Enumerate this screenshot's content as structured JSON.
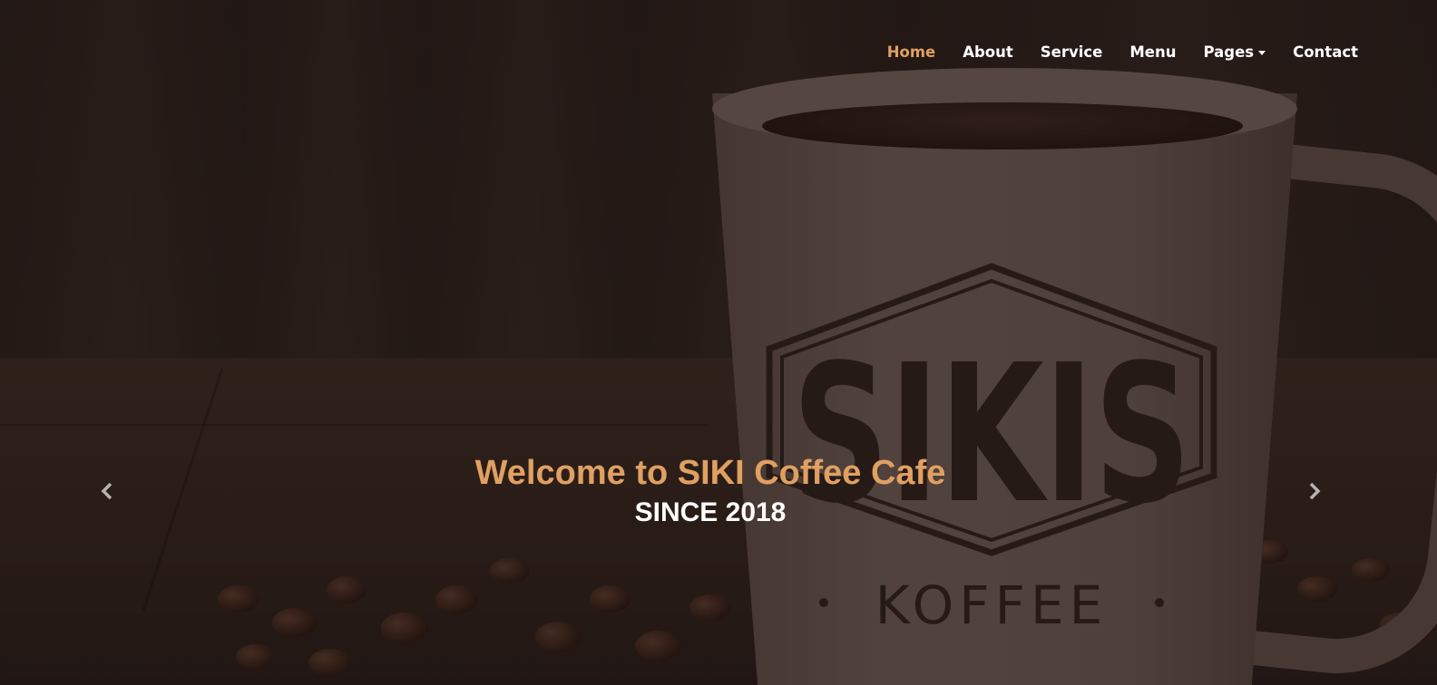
{
  "nav": {
    "items": [
      {
        "label": "Home",
        "active": true
      },
      {
        "label": "About",
        "active": false
      },
      {
        "label": "Service",
        "active": false
      },
      {
        "label": "Menu",
        "active": false
      },
      {
        "label": "Pages",
        "active": false,
        "dropdown": true
      },
      {
        "label": "Contact",
        "active": false
      }
    ],
    "active_color": "#e0a062",
    "text_color": "#ffffff"
  },
  "hero": {
    "title": "Welcome to SIKI Coffee Cafe",
    "subtitle": "SINCE 2018",
    "title_color": "#e0a062",
    "subtitle_color": "#ffffff",
    "mug_logo": {
      "brand": "SIKIS",
      "sub": "KOFFEE"
    },
    "controls": {
      "prev_icon": "chevron-left-icon",
      "next_icon": "chevron-right-icon"
    }
  }
}
